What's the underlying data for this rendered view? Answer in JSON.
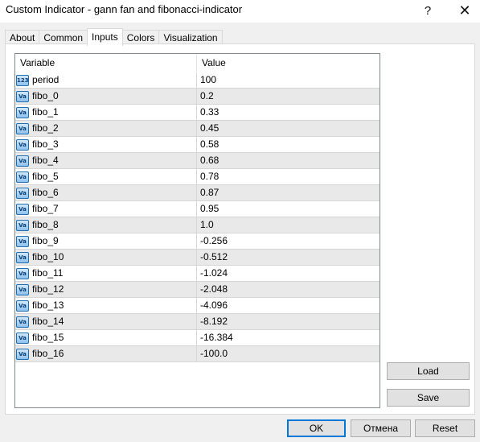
{
  "window": {
    "title": "Custom Indicator - gann fan and fibonacci-indicator",
    "help_glyph": "?",
    "close_glyph": "✕"
  },
  "tabs": [
    {
      "label": "About",
      "active": false
    },
    {
      "label": "Common",
      "active": false
    },
    {
      "label": "Inputs",
      "active": true
    },
    {
      "label": "Colors",
      "active": false
    },
    {
      "label": "Visualization",
      "active": false
    }
  ],
  "grid": {
    "columns": [
      "Variable",
      "Value"
    ],
    "rows": [
      {
        "name": "period",
        "value": "100",
        "type_icon": "123",
        "icon_name": "integer-type-icon"
      },
      {
        "name": "fibo_0",
        "value": "0.2",
        "type_icon": "Va",
        "icon_name": "double-type-icon"
      },
      {
        "name": "fibo_1",
        "value": "0.33",
        "type_icon": "Va",
        "icon_name": "double-type-icon"
      },
      {
        "name": "fibo_2",
        "value": "0.45",
        "type_icon": "Va",
        "icon_name": "double-type-icon"
      },
      {
        "name": "fibo_3",
        "value": "0.58",
        "type_icon": "Va",
        "icon_name": "double-type-icon"
      },
      {
        "name": "fibo_4",
        "value": "0.68",
        "type_icon": "Va",
        "icon_name": "double-type-icon"
      },
      {
        "name": "fibo_5",
        "value": "0.78",
        "type_icon": "Va",
        "icon_name": "double-type-icon"
      },
      {
        "name": "fibo_6",
        "value": "0.87",
        "type_icon": "Va",
        "icon_name": "double-type-icon"
      },
      {
        "name": "fibo_7",
        "value": "0.95",
        "type_icon": "Va",
        "icon_name": "double-type-icon"
      },
      {
        "name": "fibo_8",
        "value": "1.0",
        "type_icon": "Va",
        "icon_name": "double-type-icon"
      },
      {
        "name": "fibo_9",
        "value": "-0.256",
        "type_icon": "Va",
        "icon_name": "double-type-icon"
      },
      {
        "name": "fibo_10",
        "value": "-0.512",
        "type_icon": "Va",
        "icon_name": "double-type-icon"
      },
      {
        "name": "fibo_11",
        "value": "-1.024",
        "type_icon": "Va",
        "icon_name": "double-type-icon"
      },
      {
        "name": "fibo_12",
        "value": "-2.048",
        "type_icon": "Va",
        "icon_name": "double-type-icon"
      },
      {
        "name": "fibo_13",
        "value": "-4.096",
        "type_icon": "Va",
        "icon_name": "double-type-icon"
      },
      {
        "name": "fibo_14",
        "value": "-8.192",
        "type_icon": "Va",
        "icon_name": "double-type-icon"
      },
      {
        "name": "fibo_15",
        "value": "-16.384",
        "type_icon": "Va",
        "icon_name": "double-type-icon"
      },
      {
        "name": "fibo_16",
        "value": "-100.0",
        "type_icon": "Va",
        "icon_name": "double-type-icon"
      }
    ]
  },
  "buttons": {
    "load": "Load",
    "save": "Save",
    "ok": "OK",
    "cancel": "Отмена",
    "reset": "Reset"
  }
}
